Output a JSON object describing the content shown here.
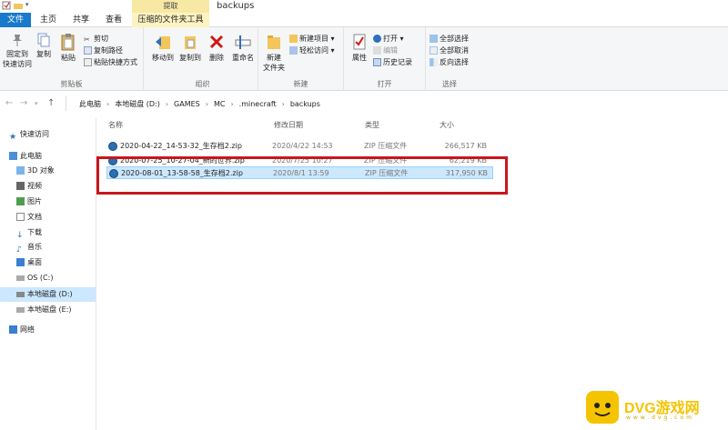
{
  "window": {
    "title": "backups",
    "context_tab_header": "提取"
  },
  "tabs": [
    {
      "label": "文件"
    },
    {
      "label": "主页"
    },
    {
      "label": "共享"
    },
    {
      "label": "查看"
    },
    {
      "label": "压缩的文件夹工具"
    }
  ],
  "ribbon": {
    "clipboard": {
      "label": "剪贴板",
      "pin_label_line1": "固定到",
      "pin_label_line2": "快速访问",
      "copy": "复制",
      "paste": "粘贴",
      "cut": "剪切",
      "copy_path": "复制路径",
      "paste_shortcut": "粘贴快捷方式"
    },
    "organize": {
      "label": "组织",
      "move_to": "移动到",
      "copy_to": "复制到",
      "delete": "删除",
      "rename": "重命名"
    },
    "new": {
      "label": "新建",
      "new_folder_line1": "新建",
      "new_folder_line2": "文件夹",
      "new_item": "新建项目",
      "easy_access": "轻松访问"
    },
    "open": {
      "label": "打开",
      "properties": "属性",
      "open": "打开",
      "edit": "编辑",
      "history": "历史记录"
    },
    "select": {
      "label": "选择",
      "select_all": "全部选择",
      "select_none": "全部取消",
      "invert": "反向选择"
    }
  },
  "address": {
    "crumbs": [
      "此电脑",
      "本地磁盘 (D:)",
      "GAMES",
      "MC",
      ".minecraft",
      "backups"
    ]
  },
  "navpane": {
    "items": [
      {
        "label": "快速访问"
      },
      {
        "label": "此电脑"
      },
      {
        "label": "3D 对象"
      },
      {
        "label": "视频"
      },
      {
        "label": "图片"
      },
      {
        "label": "文档"
      },
      {
        "label": "下载"
      },
      {
        "label": "音乐"
      },
      {
        "label": "桌面"
      },
      {
        "label": "OS (C:)"
      },
      {
        "label": "本地磁盘 (D:)"
      },
      {
        "label": "本地磁盘 (E:)"
      },
      {
        "label": "网络"
      }
    ]
  },
  "filelist": {
    "columns": [
      "名称",
      "修改日期",
      "类型",
      "大小"
    ],
    "rows": [
      {
        "name": "2020-04-22_14-53-32_生存档2.zip",
        "date": "2020/4/22 14:53",
        "type": "ZIP 压缩文件",
        "size": "266,517 KB"
      },
      {
        "name": "2020-07-25_10-27-04_新的世界.zip",
        "date": "2020/7/25 10:27",
        "type": "ZIP 压缩文件",
        "size": "62,219 KB"
      },
      {
        "name": "2020-08-01_13-58-58_生存档2.zip",
        "date": "2020/8/1 13:59",
        "type": "ZIP 压缩文件",
        "size": "317,950 KB"
      }
    ]
  },
  "watermark": {
    "text": "DVG游戏网",
    "sub": "www.dvg.com"
  },
  "colors": {
    "accent": "#1979ca",
    "selection": "#cce8ff",
    "highlight_box": "#c8161d",
    "watermark": "#f5c400"
  }
}
